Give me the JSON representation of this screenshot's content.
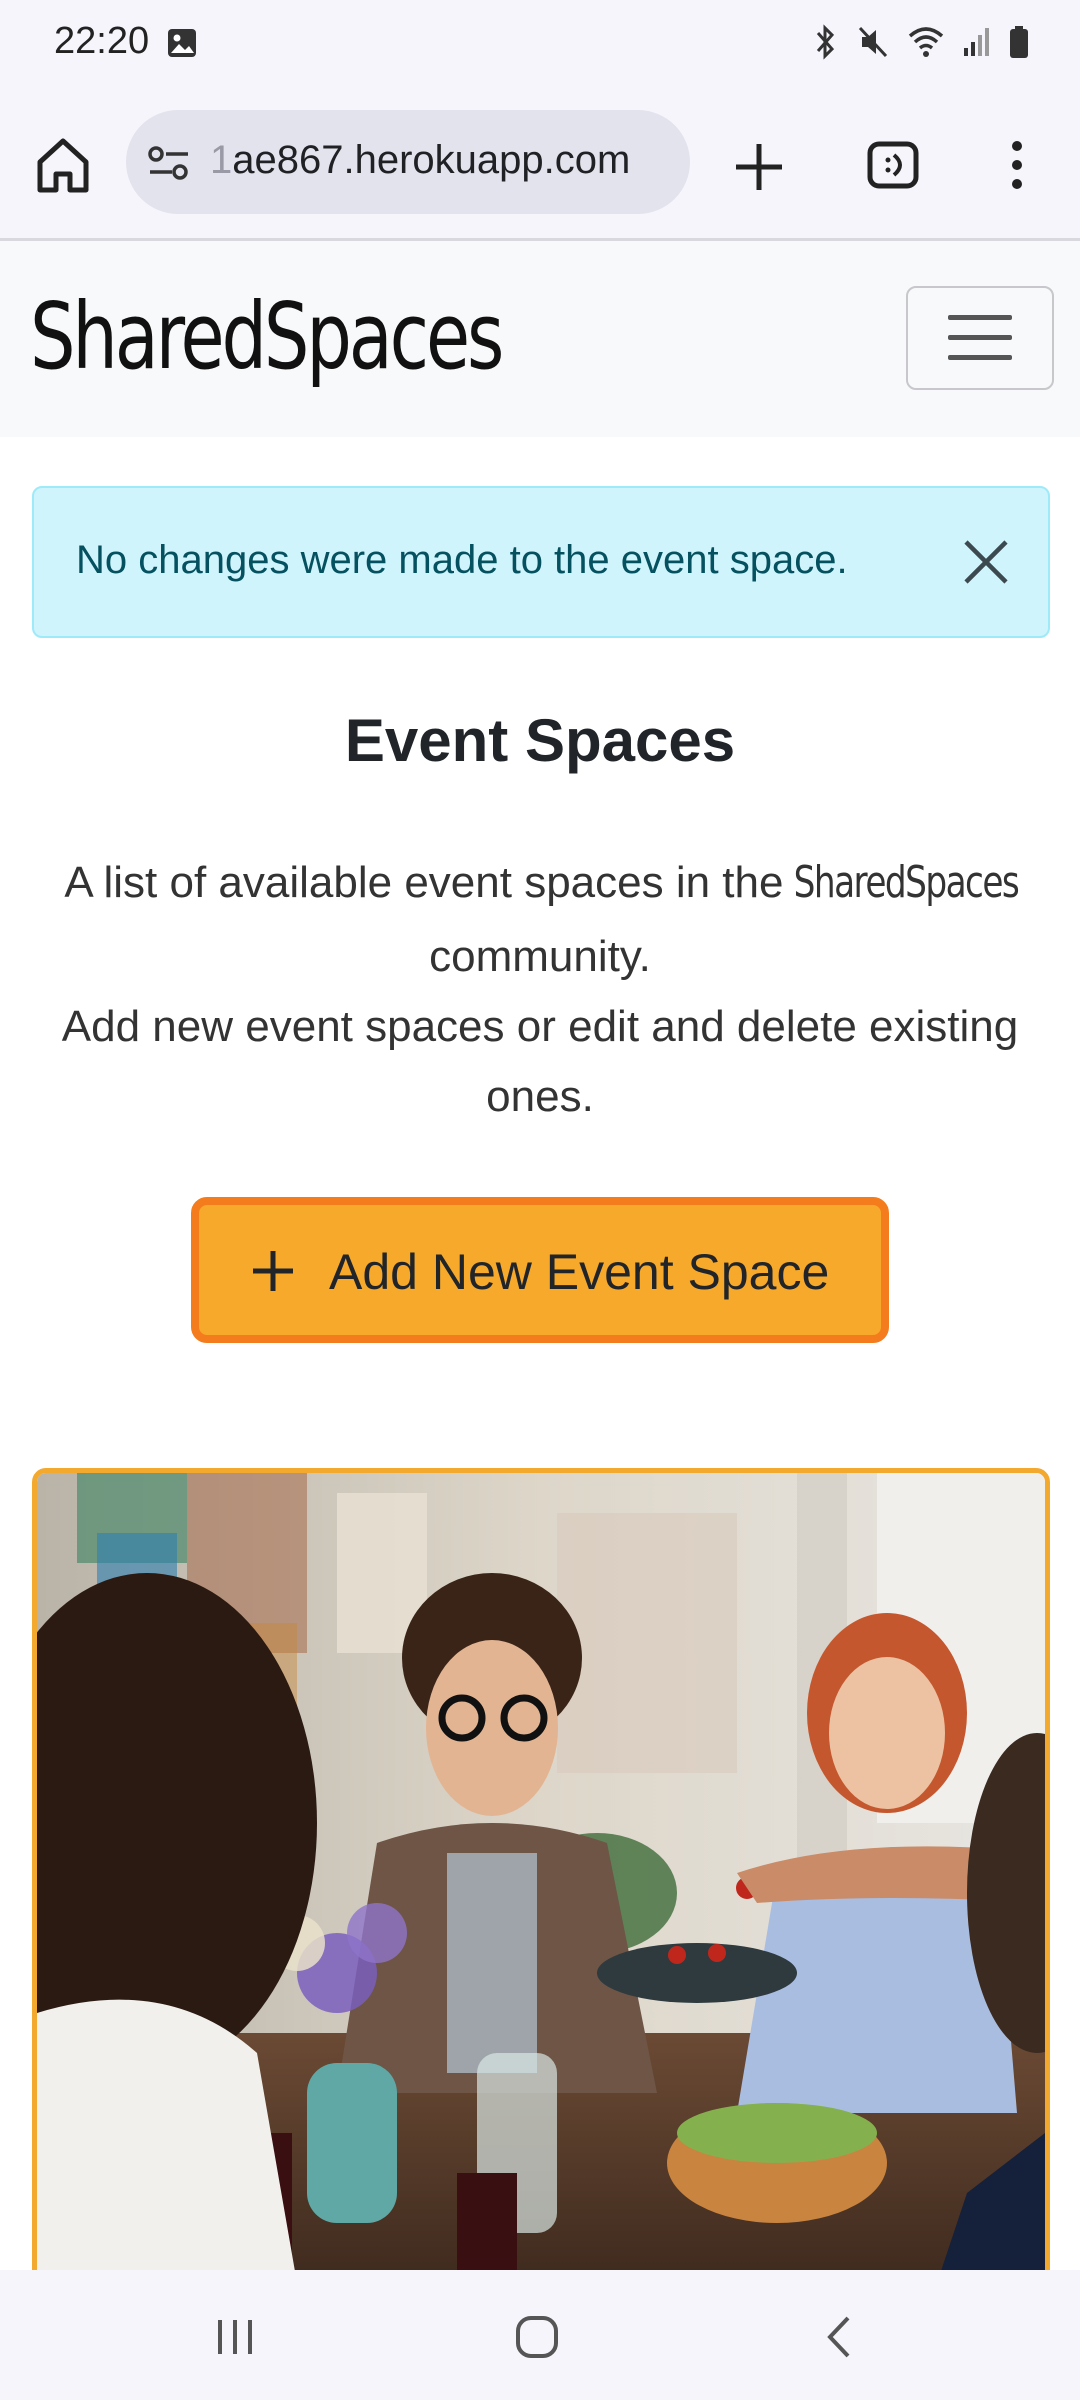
{
  "status": {
    "time": "22:20"
  },
  "browser": {
    "url_prefix": "1",
    "url": "ae867.herokuapp.com"
  },
  "navbar": {
    "brand": "SharedSpaces"
  },
  "alert": {
    "message": "No changes were made to the event space."
  },
  "main": {
    "title": "Event Spaces",
    "lead_part1": "A list of available event spaces in the",
    "lead_brand": "SharedSpaces",
    "lead_part2": "community.",
    "lead_line2": "Add new event spaces or edit and delete existing ones.",
    "add_button_label": "Add New Event Space"
  },
  "colors": {
    "accent": "#f6a92a",
    "accent_border": "#f47c1c",
    "alert_bg": "#cff4fc",
    "alert_text": "#055160"
  }
}
